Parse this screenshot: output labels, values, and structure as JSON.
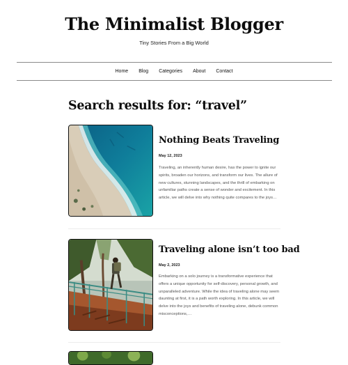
{
  "site": {
    "title": "The Minimalist Blogger",
    "tagline": "Tiny Stories From a Big World"
  },
  "nav": {
    "items": [
      "Home",
      "Blog",
      "Categories",
      "About",
      "Contact"
    ]
  },
  "search": {
    "heading": "Search results for: “travel”"
  },
  "posts": [
    {
      "title": "Nothing Beats Traveling",
      "date": "May 12, 2023",
      "excerpt": "Traveling, an inherently human desire, has the power to ignite our spirits, broaden our horizons, and transform our lives. The allure of new cultures, stunning landscapes, and the thrill of embarking on unfamiliar paths create a sense of wonder and excitement. In this article, we will delve into why nothing quite compares to the joys…",
      "image_icon": "coastline-aerial-photo"
    },
    {
      "title": "Traveling alone isn’t too bad",
      "date": "May 2, 2023",
      "excerpt": "Embarking on a solo journey is a transformative experience that offers a unique opportunity for self-discovery, personal growth, and unparalleled adventure. While the idea of traveling alone may seem daunting at first, it is a path worth exploring. In this article, we will delve into the joys and benefits of traveling alone, debunk common misconceptions,…",
      "image_icon": "hiker-stairs-photo"
    },
    {
      "image_icon": "forest-photo"
    }
  ]
}
